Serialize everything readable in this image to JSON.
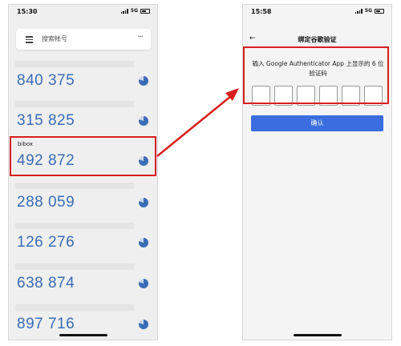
{
  "left_phone": {
    "status": {
      "time": "15:30",
      "network": "5G"
    },
    "search": {
      "placeholder": "搜索帐号",
      "more": "···"
    },
    "codes": [
      {
        "label": "",
        "code": "840 375",
        "remaining": 0.8
      },
      {
        "label": "",
        "code": "315 825",
        "remaining": 0.8
      },
      {
        "label": "bibox",
        "code": "492 872",
        "remaining": 0.8
      },
      {
        "label": "",
        "code": "288 059",
        "remaining": 0.8
      },
      {
        "label": "",
        "code": "126 276",
        "remaining": 0.8
      },
      {
        "label": "",
        "code": "638 874",
        "remaining": 0.8
      },
      {
        "label": "",
        "code": "897 716",
        "remaining": 0.8
      }
    ]
  },
  "right_phone": {
    "status": {
      "time": "15:58",
      "network": "5G"
    },
    "back": "←",
    "title": "绑定谷歌验证",
    "instruction": "输入 Google Authenticator App 上显示的 6 位验证码",
    "code_boxes": 6,
    "confirm_label": "确认"
  },
  "colors": {
    "accent": "#3a6ddf",
    "code_blue": "#3a6db5",
    "highlight": "#d81e1e"
  }
}
